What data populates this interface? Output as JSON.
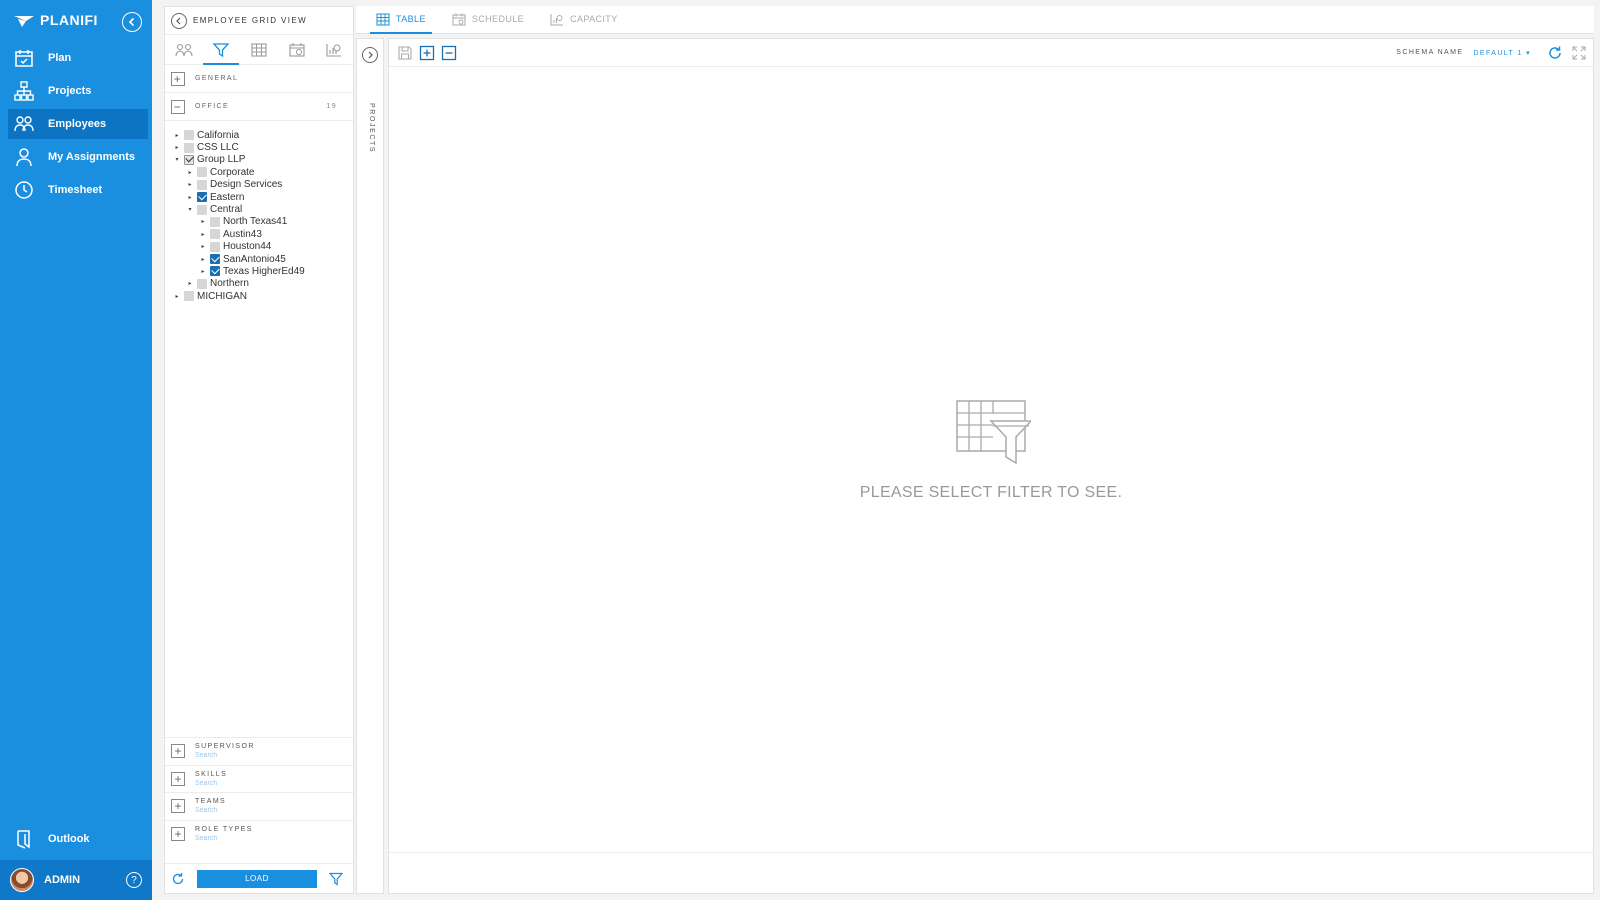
{
  "app": {
    "brand": "PLANIFI",
    "accent": "#1a8fe0",
    "user": "ADMIN"
  },
  "nav": {
    "items": [
      {
        "label": "Plan",
        "icon": "calendar-icon"
      },
      {
        "label": "Projects",
        "icon": "hierarchy-icon"
      },
      {
        "label": "Employees",
        "icon": "people-icon",
        "active": true
      },
      {
        "label": "My Assignments",
        "icon": "person-icon"
      },
      {
        "label": "Timesheet",
        "icon": "clock-icon"
      }
    ],
    "outlook": "Outlook"
  },
  "filter_panel": {
    "title": "EMPLOYEE GRID VIEW",
    "sections": {
      "general": "GENERAL",
      "office": "OFFICE",
      "office_count": "19"
    },
    "tree": [
      {
        "label": "California",
        "depth": 0,
        "expanded": false,
        "checked": false
      },
      {
        "label": "CSS LLC",
        "depth": 0,
        "expanded": false,
        "checked": false
      },
      {
        "label": "Group LLP",
        "depth": 0,
        "expanded": true,
        "checked": true
      },
      {
        "label": "Corporate",
        "depth": 1,
        "expanded": false,
        "checked": false
      },
      {
        "label": "Design Services",
        "depth": 1,
        "expanded": false,
        "checked": false
      },
      {
        "label": "Eastern",
        "depth": 1,
        "expanded": false,
        "checked": true
      },
      {
        "label": "Central",
        "depth": 1,
        "expanded": true,
        "checked": false
      },
      {
        "label": "North Texas41",
        "depth": 2,
        "expanded": false,
        "checked": false
      },
      {
        "label": "Austin43",
        "depth": 2,
        "expanded": false,
        "checked": false
      },
      {
        "label": "Houston44",
        "depth": 2,
        "expanded": false,
        "checked": false
      },
      {
        "label": "SanAntonio45",
        "depth": 2,
        "expanded": false,
        "checked": true
      },
      {
        "label": "Texas HigherEd49",
        "depth": 2,
        "expanded": false,
        "checked": true
      },
      {
        "label": "Northern",
        "depth": 1,
        "expanded": false,
        "checked": false
      },
      {
        "label": "MICHIGAN",
        "depth": 0,
        "expanded": false,
        "checked": false
      }
    ],
    "bottom_sections": [
      {
        "title": "SUPERVISOR",
        "placeholder": "Search"
      },
      {
        "title": "SKILLS",
        "placeholder": "Search"
      },
      {
        "title": "TEAMS",
        "placeholder": "Search"
      },
      {
        "title": "ROLE TYPES",
        "placeholder": "Search"
      }
    ],
    "load_label": "LOAD"
  },
  "top_tabs": [
    {
      "label": "TABLE",
      "active": true
    },
    {
      "label": "SCHEDULE",
      "active": false
    },
    {
      "label": "CAPACITY",
      "active": false
    }
  ],
  "side_strip": {
    "label": "PROJECTS"
  },
  "toolbar": {
    "schema_label": "SCHEMA NAME",
    "schema_value": "DEFAULT 1 ▾"
  },
  "empty_state": {
    "message": "PLEASE SELECT FILTER TO SEE."
  }
}
